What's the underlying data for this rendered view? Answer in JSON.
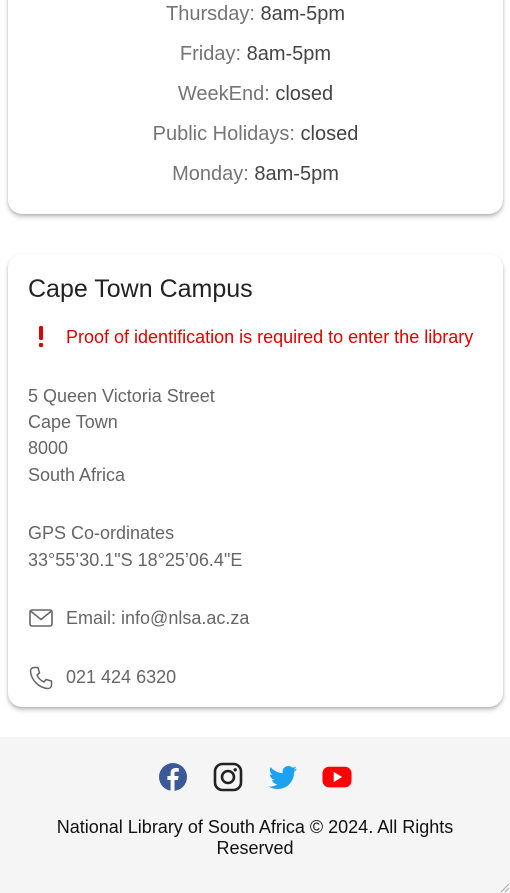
{
  "hours": [
    {
      "day": "Thursday",
      "time": "8am-5pm"
    },
    {
      "day": "Friday",
      "time": "8am-5pm"
    },
    {
      "day": "WeekEnd",
      "time": "closed"
    },
    {
      "day": "Public Holidays",
      "time": "closed"
    },
    {
      "day": "Monday",
      "time": "8am-5pm"
    }
  ],
  "campus": {
    "title": "Cape Town Campus",
    "alert": "Proof of identification is required to enter the library",
    "address": [
      "5 Queen Victoria Street",
      "Cape Town",
      "8000",
      "South Africa"
    ],
    "gps_label": "GPS Co-ordinates",
    "gps_value": "33°55’30.1\"S 18°25’06.4\"E",
    "email_label": "Email:",
    "email": "info@nlsa.ac.za",
    "phone": "021 424 6320"
  },
  "footer": {
    "social": [
      "facebook-icon",
      "instagram-icon",
      "twitter-icon",
      "youtube-icon"
    ],
    "copyright": "National Library of South Africa © 2024. All Rights Reserved"
  },
  "colors": {
    "alert": "#e00000",
    "facebook": "#3b5998",
    "twitter": "#1da1f2",
    "youtube": "#ff0000"
  }
}
